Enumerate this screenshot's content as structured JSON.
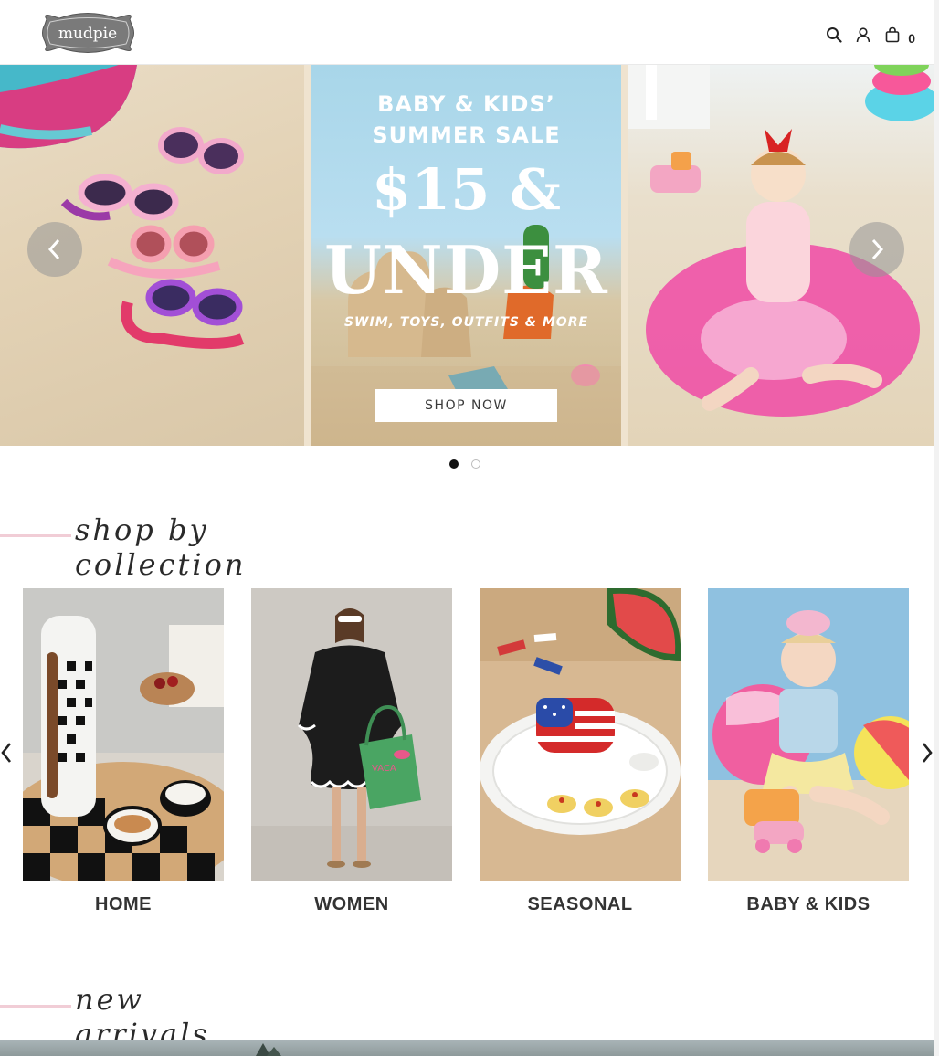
{
  "header": {
    "logo_text": "mudpie",
    "cart_count": "0",
    "icons": [
      "search-icon",
      "account-icon",
      "cart-icon"
    ]
  },
  "hero": {
    "title_line1": "BABY & KIDS’",
    "title_line2": "SUMMER SALE",
    "big_line1": "$15 &",
    "big_line2": "UNDER",
    "subtitle": "SWIM, TOYS, OUTFITS & MORE",
    "cta_label": "SHOP NOW",
    "slide_count": 2,
    "active_slide": 1
  },
  "collections": {
    "heading": "shop by collection",
    "items": [
      {
        "label": "HOME"
      },
      {
        "label": "WOMEN"
      },
      {
        "label": "SEASONAL"
      },
      {
        "label": "BABY & KIDS"
      }
    ]
  },
  "new_arrivals": {
    "heading": "new arrivals"
  },
  "colors": {
    "accent_pink_line": "#f1cdd6",
    "text_dark": "#333333",
    "dot_active": "#111111"
  }
}
